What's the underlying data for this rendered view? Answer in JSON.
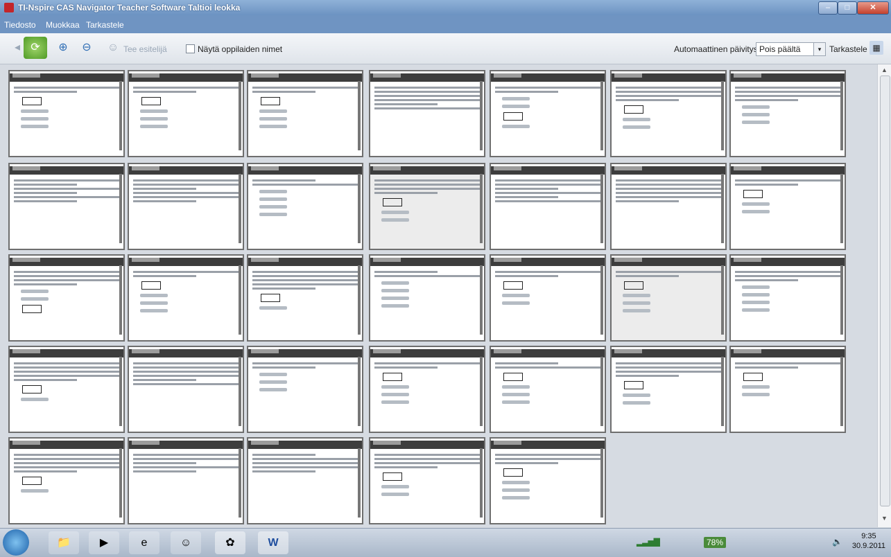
{
  "window": {
    "title": "TI-Nspire CAS Navigator Teacher Software  Taltioi leokka",
    "controls": [
      "–",
      "□",
      "✕"
    ]
  },
  "menu": [
    "Tiedosto",
    "Muokkaa",
    "Tarkastele"
  ],
  "toolbar": {
    "show_label": "Tee esitelijä",
    "show_names_label": "Näytä oppilaiden nimet",
    "auto_update_label": "Automaattinen päivitys",
    "auto_update_value": "Pois päältä",
    "view_label": "Tarkastele"
  },
  "icons": {
    "refresh": "refresh-icon",
    "zoom_in": "zoom-in-icon",
    "zoom_out": "zoom-out-icon",
    "user": "user-icon",
    "view": "view-icon"
  },
  "taskbar": {
    "time": "9:35",
    "date": "30.9.2011",
    "battery": "78%"
  }
}
